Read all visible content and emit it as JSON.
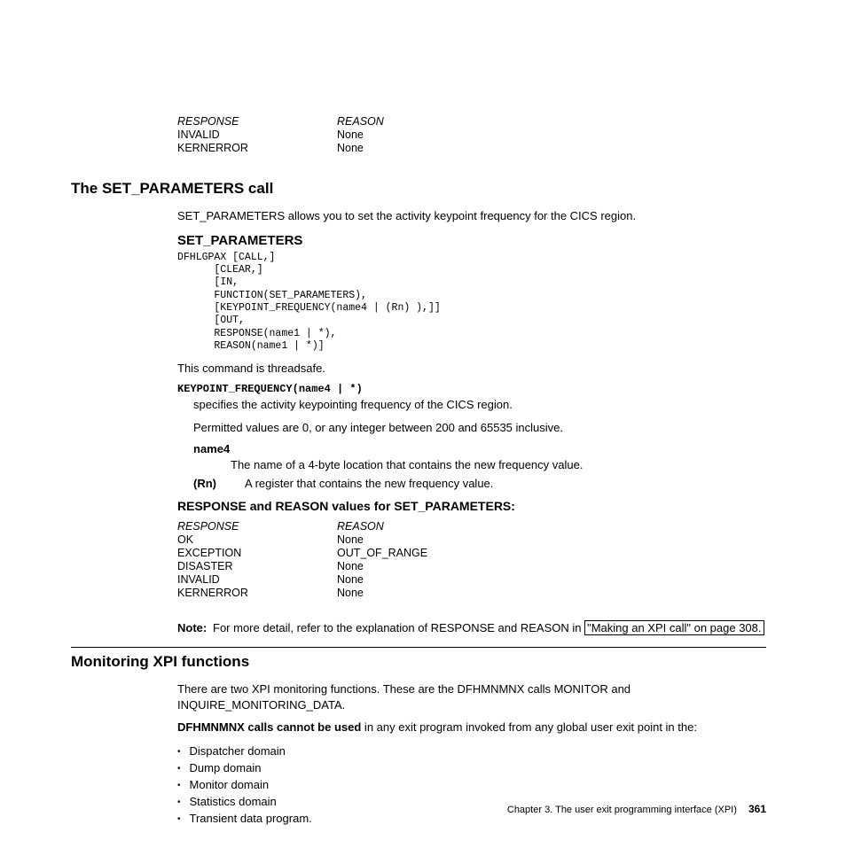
{
  "top_table": {
    "headers": [
      "RESPONSE",
      "REASON"
    ],
    "rows": [
      [
        "INVALID",
        "None"
      ],
      [
        "KERNERROR",
        "None"
      ]
    ]
  },
  "section1": {
    "title": "The SET_PARAMETERS call",
    "intro": "SET_PARAMETERS allows you to set the activity keypoint frequency for the CICS region.",
    "sub": "SET_PARAMETERS",
    "code": "DFHLGPAX [CALL,]\n      [CLEAR,]\n      [IN,\n      FUNCTION(SET_PARAMETERS),\n      [KEYPOINT_FREQUENCY(name4 | (Rn) ),]]\n      [OUT,\n      RESPONSE(name1 | *),\n      REASON(name1 | *)]",
    "threadsafe": "This command is threadsafe.",
    "kp_term": "KEYPOINT_FREQUENCY(name4 | *)",
    "kp_desc": "specifies the activity keypointing frequency of the CICS region.",
    "kp_perm": "Permitted values are 0, or any integer between 200 and 65535 inclusive.",
    "name4_k": "name4",
    "name4_v": "The name of a 4-byte location that contains the new frequency value.",
    "rn_k": "(Rn)",
    "rn_v": "A register that contains the new frequency value.",
    "rr_title": "RESPONSE and REASON values for SET_PARAMETERS:",
    "rr_table": {
      "headers": [
        "RESPONSE",
        "REASON"
      ],
      "rows": [
        [
          "OK",
          "None"
        ],
        [
          "EXCEPTION",
          "OUT_OF_RANGE"
        ],
        [
          "DISASTER",
          "None"
        ],
        [
          "INVALID",
          "None"
        ],
        [
          "KERNERROR",
          "None"
        ]
      ]
    },
    "note_k": "Note:",
    "note_pre": "For more detail, refer to the explanation of RESPONSE and REASON in ",
    "note_link": "\"Making an XPI call\" on page 308."
  },
  "section2": {
    "title": "Monitoring XPI functions",
    "intro": "There are two XPI monitoring functions. These are the DFHMNMNX calls MONITOR and INQUIRE_MONITORING_DATA.",
    "bold": "DFHMNMNX calls cannot be used",
    "warn_rest": " in any exit program invoked from any global user exit point in the:",
    "bullets": [
      "Dispatcher domain",
      "Dump domain",
      "Monitor domain",
      "Statistics domain",
      "Transient data program."
    ]
  },
  "footer": {
    "chapter": "Chapter 3. The user exit programming interface (XPI)",
    "page": "361"
  }
}
